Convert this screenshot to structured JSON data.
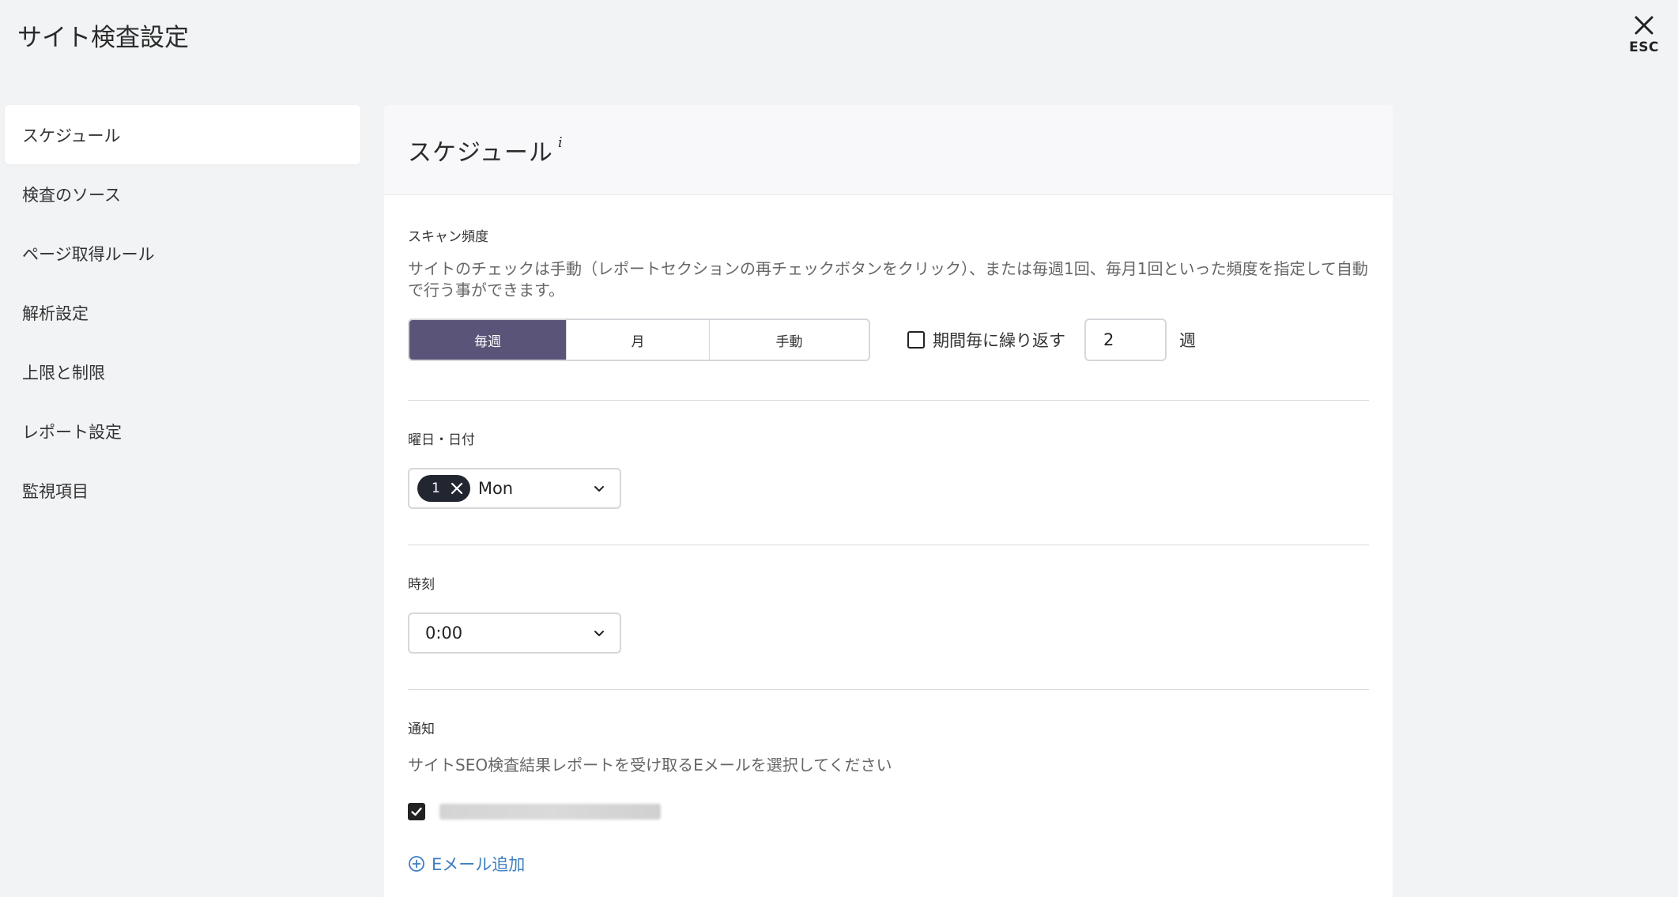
{
  "page": {
    "title": "サイト検査設定"
  },
  "close": {
    "label": "ESC"
  },
  "sidebar": {
    "items": [
      {
        "label": "スケジュール"
      },
      {
        "label": "検査のソース"
      },
      {
        "label": "ページ取得ルール"
      },
      {
        "label": "解析設定"
      },
      {
        "label": "上限と制限"
      },
      {
        "label": "レポート設定"
      },
      {
        "label": "監視項目"
      }
    ],
    "active_index": 0
  },
  "panel": {
    "title": "スケジュール",
    "info_marker": "i",
    "scan": {
      "label": "スキャン頻度",
      "description": "サイトのチェックは手動（レポートセクションの再チェックボタンをクリック）、または毎週1回、毎月1回といった頻度を指定して自動で行う事ができます。",
      "options": [
        {
          "label": "毎週",
          "active": true
        },
        {
          "label": "月",
          "active": false
        },
        {
          "label": "手動",
          "active": false
        }
      ],
      "repeat_label": "期間毎に繰り返す",
      "repeat_checked": false,
      "repeat_value": "2",
      "repeat_unit": "週"
    },
    "day": {
      "label": "曜日・日付",
      "chip_count": "1",
      "selected": "Mon"
    },
    "time": {
      "label": "時刻",
      "selected": "0:00"
    },
    "notify": {
      "label": "通知",
      "description": "サイトSEO検査結果レポートを受け取るEメールを選択してください",
      "email_checked": true,
      "add_label": "Eメール追加"
    }
  },
  "colors": {
    "background": "#f2f3f5",
    "segment_active": "#5a5478",
    "chip_bg": "#222630",
    "link": "#3d7fc1"
  },
  "icons": {
    "close": "close-icon",
    "chevron": "chevron-down-icon",
    "add": "plus-circle-icon",
    "check": "check-icon"
  }
}
